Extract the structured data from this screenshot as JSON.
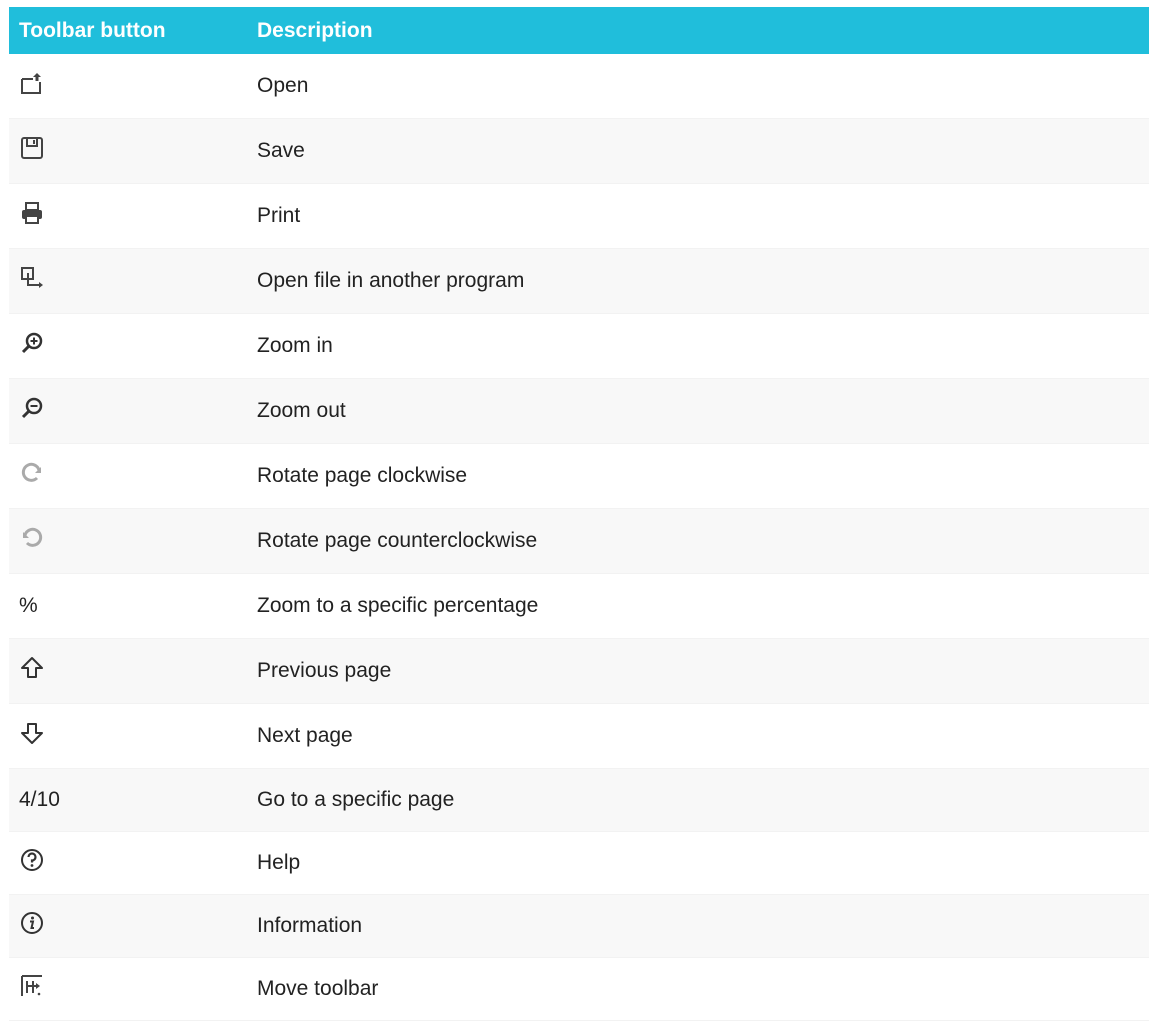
{
  "table": {
    "headers": [
      "Toolbar button",
      "Description"
    ],
    "rows": [
      {
        "icon": "open-icon",
        "button_text": "",
        "description": "Open"
      },
      {
        "icon": "save-icon",
        "button_text": "",
        "description": "Save"
      },
      {
        "icon": "print-icon",
        "button_text": "",
        "description": "Print"
      },
      {
        "icon": "open-in-program-icon",
        "button_text": "",
        "description": "Open file in another program"
      },
      {
        "icon": "zoom-in-icon",
        "button_text": "",
        "description": "Zoom in"
      },
      {
        "icon": "zoom-out-icon",
        "button_text": "",
        "description": "Zoom out"
      },
      {
        "icon": "rotate-clockwise-icon",
        "button_text": "",
        "description": "Rotate page clockwise"
      },
      {
        "icon": "rotate-counterclockwise-icon",
        "button_text": "",
        "description": "Rotate page counterclockwise"
      },
      {
        "icon": "",
        "button_text": "%",
        "description": "Zoom to a specific percentage"
      },
      {
        "icon": "previous-page-icon",
        "button_text": "",
        "description": "Previous page"
      },
      {
        "icon": "next-page-icon",
        "button_text": "",
        "description": "Next page"
      },
      {
        "icon": "",
        "button_text": "4/10",
        "description": "Go to a specific page"
      },
      {
        "icon": "help-icon",
        "button_text": "",
        "description": "Help"
      },
      {
        "icon": "information-icon",
        "button_text": "",
        "description": "Information"
      },
      {
        "icon": "move-toolbar-icon",
        "button_text": "",
        "description": "Move toolbar"
      }
    ]
  },
  "colors": {
    "header_background": "#20bedb",
    "header_text": "#ffffff",
    "stripe": "#f8f8f8"
  }
}
